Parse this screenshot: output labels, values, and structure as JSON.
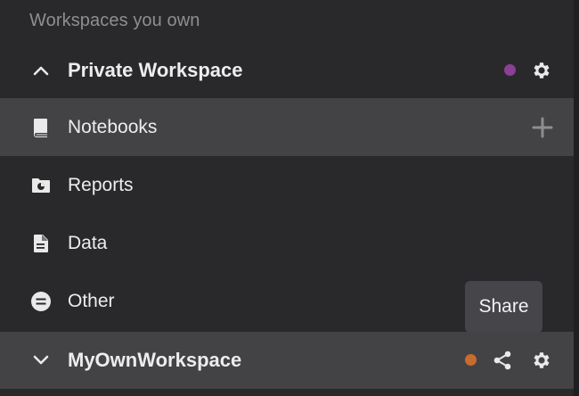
{
  "sidebar": {
    "section_title": "Workspaces you own",
    "workspaces": [
      {
        "name": "Private Workspace",
        "expanded": true,
        "status_color": "#8b3f95",
        "items": [
          {
            "label": "Notebooks",
            "icon": "book-icon",
            "highlighted": true
          },
          {
            "label": "Reports",
            "icon": "report-folder-icon"
          },
          {
            "label": "Data",
            "icon": "document-icon"
          },
          {
            "label": "Other",
            "icon": "equals-circle-icon"
          }
        ]
      },
      {
        "name": "MyOwnWorkspace",
        "expanded": false,
        "status_color": "#c96b2c",
        "highlighted": true
      }
    ]
  },
  "tooltip": {
    "text": "Share"
  },
  "colors": {
    "background": "#29292c",
    "highlight": "#434346",
    "text": "#ededee",
    "muted": "#8e8e92"
  }
}
